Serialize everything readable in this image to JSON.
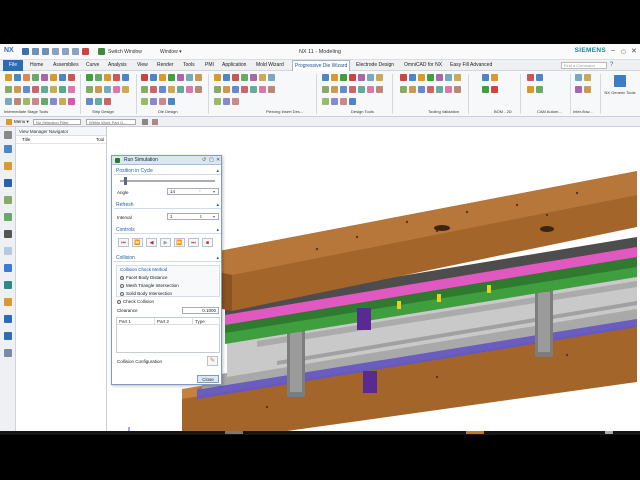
{
  "window": {
    "logo": "NX",
    "switch_window": "Switch Window",
    "window_menu": "Window ▾",
    "title": "NX 11 - Modeling",
    "brand": "SIEMENS"
  },
  "menu": {
    "file": "File",
    "tabs": [
      "Home",
      "Assemblies",
      "Curve",
      "Analysis",
      "View",
      "Render",
      "Tools",
      "PMI",
      "Application",
      "Mold Wizard",
      "Progressive Die Wizard",
      "Electrode Design",
      "OmniCAD for NX",
      "Easy Fill Advanced"
    ],
    "command_search": "Find a Command"
  },
  "ribbon": {
    "groups": [
      "Intermediate Stage Tools",
      "Strip Design",
      "Die Design",
      "Piercing Insert Des...",
      "Design Tools",
      "Tooling Validation",
      "BOM - 2D",
      "CAM Autom...",
      "Inter-flow...",
      "NX Generic Tools"
    ]
  },
  "selection_bar": {
    "menu": "Menu ▾",
    "filter": "No Selection Filter",
    "scope": "Within Work Part O..."
  },
  "navigator": {
    "title": "View Manager Navigator",
    "col_title": "Title",
    "col_tool": "Tool"
  },
  "dialog": {
    "title": "Run Simulation",
    "position_section": "Position in Cycle",
    "angle_label": "Angle",
    "angle_value": "14",
    "angle_unit": "°",
    "refresh_section": "Refresh",
    "interval_label": "Interval",
    "interval_value": "1",
    "controls_section": "Controls",
    "controls": [
      "⏮",
      "⏪",
      "◀",
      "▶",
      "⏩",
      "⏭",
      "■"
    ],
    "collision_section": "Collision",
    "check_method_label": "Collision Check Method",
    "methods": [
      "Facet Body Distance",
      "Mesh Triangle Intersection",
      "Solid Body Intersection"
    ],
    "check_collision": "Check Collision",
    "clearance_label": "Clearance",
    "clearance_value": "0.1000",
    "table_headers": [
      "Part 1",
      "Part 2",
      "Type"
    ],
    "collision_config": "Collision Configuration",
    "close_button": "Close"
  },
  "colors": {
    "wood": "#a4652a",
    "plate_gray": "#b9b9b9",
    "pink": "#e058c0",
    "green": "#3f9f3f",
    "purple": "#5a2a93",
    "accent_blue": "#2b6cb3"
  }
}
